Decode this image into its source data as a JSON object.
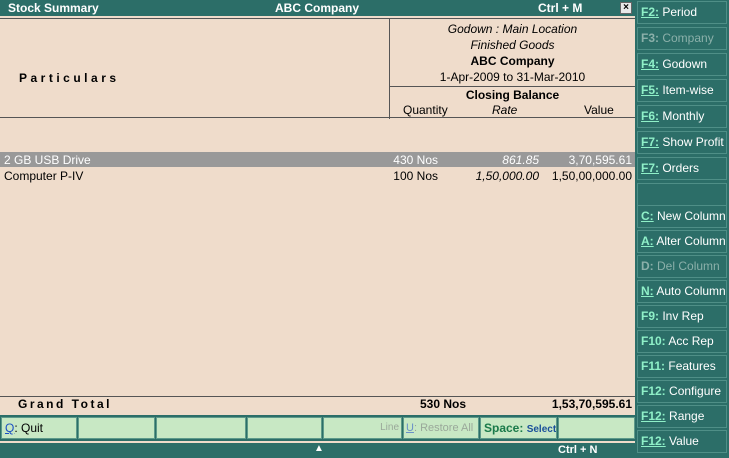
{
  "titlebar": {
    "left": "Stock Summary",
    "center": "ABC Company",
    "right": "Ctrl + M",
    "close": "×"
  },
  "header": {
    "particulars": "Particulars",
    "godown": "Godown : Main Location",
    "group": "Finished Goods",
    "company": "ABC Company",
    "period": "1-Apr-2009 to 31-Mar-2010",
    "closing_balance": "Closing Balance",
    "col_quantity": "Quantity",
    "col_rate": "Rate",
    "col_value": "Value"
  },
  "rows": [
    {
      "name": "2 GB USB Drive",
      "quantity": "430 Nos",
      "rate": "861.85",
      "value": "3,70,595.61",
      "selected": true
    },
    {
      "name": "Computer P-IV",
      "quantity": "100 Nos",
      "rate": "1,50,000.00",
      "value": "1,50,00,000.00",
      "selected": false
    }
  ],
  "grand_total": {
    "label": "Grand Total",
    "quantity": "530 Nos",
    "value": "1,53,70,595.61"
  },
  "bottom_buttons": {
    "quit_key": "Q",
    "quit_label": ": Quit",
    "line_label": "Line",
    "restore_key": "U",
    "restore_label": ": Restore All",
    "space_key": "Space:",
    "space_label": "Select"
  },
  "status": {
    "arrow": "▲",
    "right": "Ctrl + N"
  },
  "sidebar": {
    "items": [
      {
        "key": "F2:",
        "label": "Period"
      },
      {
        "key": "F3:",
        "label": "Company"
      },
      {
        "key": "F4:",
        "label": "Godown"
      },
      {
        "key": "F5:",
        "label": "Item-wise"
      },
      {
        "key": "F6:",
        "label": "Monthly"
      },
      {
        "key": "F7:",
        "label": "Show Profit"
      },
      {
        "key": "F7:",
        "label": "Orders"
      },
      {
        "key": "C:",
        "label": "New Column"
      },
      {
        "key": "A:",
        "label": "Alter Column"
      },
      {
        "key": "D:",
        "label": "Del Column"
      },
      {
        "key": "N:",
        "label": "Auto Column"
      },
      {
        "key": "F9:",
        "label": "Inv Rep"
      },
      {
        "key": "F10:",
        "label": "Acc Rep"
      },
      {
        "key": "F11:",
        "label": "Features"
      },
      {
        "key": "F12:",
        "label": "Configure"
      },
      {
        "key": "F12:",
        "label": "Range"
      },
      {
        "key": "F12:",
        "label": "Value"
      }
    ]
  },
  "colors": {
    "teal": "#2c6e68",
    "background": "#efdccb",
    "selected_row": "#999999",
    "button_green": "#c8e8c4",
    "key_cyan": "#8ff0c8"
  }
}
